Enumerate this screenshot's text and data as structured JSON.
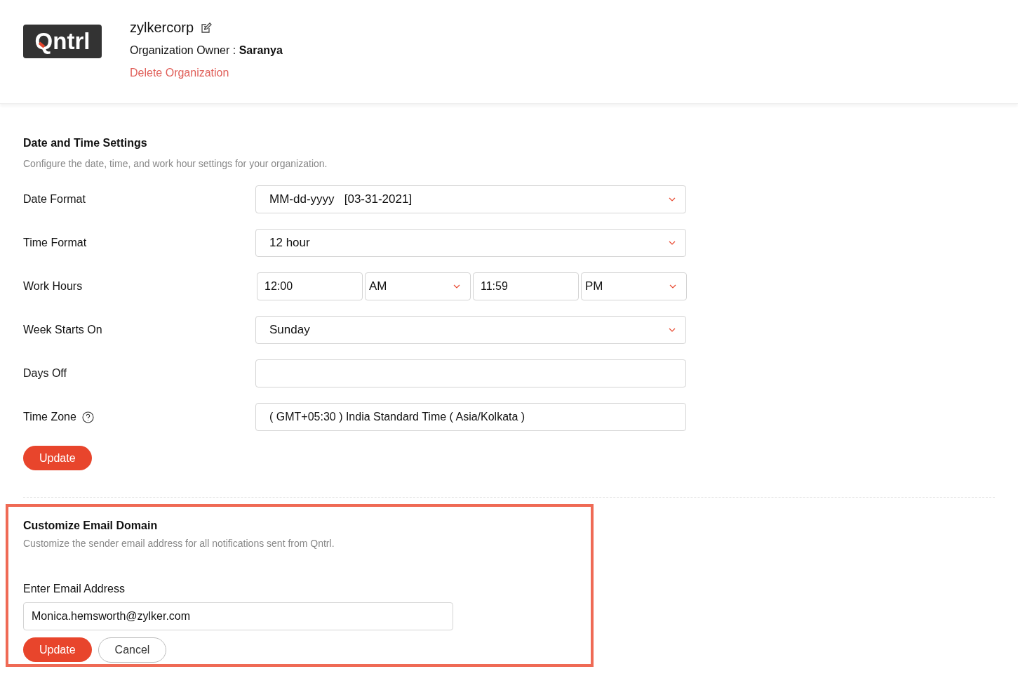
{
  "header": {
    "logo": "Qntrl",
    "org_name": "zylkercorp",
    "owner_label": "Organization Owner : ",
    "owner_name": "Saranya",
    "delete_link": "Delete Organization"
  },
  "date_time": {
    "title": "Date and Time Settings",
    "description": "Configure the date, time, and work hour settings for your organization.",
    "rows": [
      {
        "kind": "select",
        "label": "Date Format",
        "value": "MM-dd-yyyy   [03-31-2021]"
      },
      {
        "kind": "select",
        "label": "Time Format",
        "value": "12 hour"
      },
      {
        "kind": "hours",
        "label": "Work Hours",
        "start": "12:00",
        "start_period": "AM",
        "end": "11:59",
        "end_period": "PM"
      },
      {
        "kind": "select",
        "label": "Week Starts On",
        "value": "Sunday"
      },
      {
        "kind": "text",
        "label": "Days Off",
        "value": ""
      },
      {
        "kind": "text",
        "label": "Time Zone",
        "help": true,
        "value": "( GMT+05:30 ) India Standard Time ( Asia/Kolkata )"
      }
    ],
    "update_button": "Update"
  },
  "email_domain": {
    "highlighted": true,
    "title": "Customize Email Domain",
    "description": "Customize the sender email address for all notifications sent from Qntrl.",
    "field_label": "Enter Email Address",
    "value": "Monica.hemsworth@zylker.com",
    "update_button": "Update",
    "cancel_button": "Cancel"
  }
}
